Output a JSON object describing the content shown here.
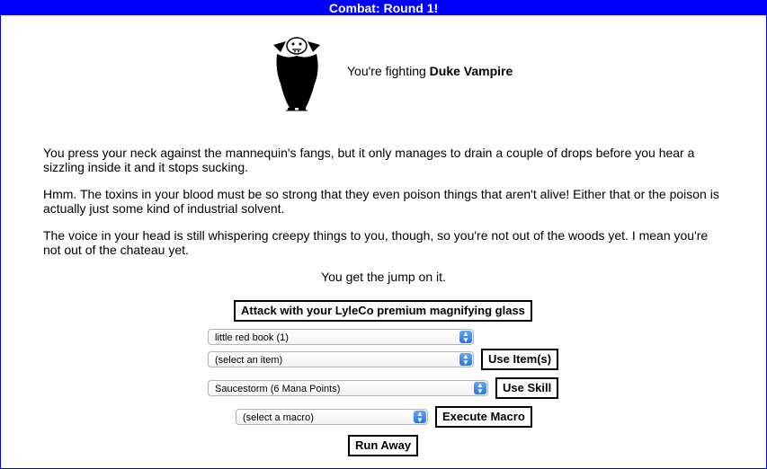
{
  "title": "Combat: Round 1!",
  "monster": {
    "prefix": "You're fighting ",
    "name": "Duke Vampire"
  },
  "story": [
    "You press your neck against the mannequin's fangs, but it only manages to drain a couple of drops before you hear a sizzling inside it and it stops sucking.",
    "Hmm. The toxins in your blood must be so strong that they even poison things that aren't alive! Either that or the poison is actually just some kind of industrial solvent.",
    "The voice in your head is still whispering creepy things to you, though, so you're not out of the woods yet. I mean you're not out of the chateau yet."
  ],
  "jump_text": "You get the jump on it.",
  "attack_label": "Attack with your LyleCo premium magnifying glass",
  "item1_value": "little red book (1)",
  "item2_value": "(select an item)",
  "use_items_label": "Use Item(s)",
  "skill_value": "Saucestorm (6 Mana Points)",
  "use_skill_label": "Use Skill",
  "macro_value": "(select a macro)",
  "execute_macro_label": "Execute Macro",
  "run_away_label": "Run Away",
  "colors": {
    "titlebar": "#0000ff",
    "select_arrow": "#2a75e0"
  },
  "icons": {
    "monster": "vampire-icon",
    "dropdown": "updown-arrows-icon"
  }
}
